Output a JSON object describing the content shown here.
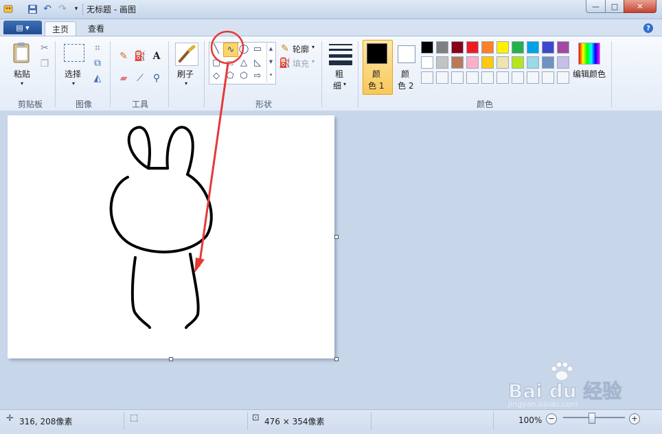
{
  "window": {
    "title": "无标题 - 画图",
    "controls": {
      "minimize": "—",
      "maximize": "□",
      "close": "✕"
    }
  },
  "quick_access": {
    "icons": [
      "app-icon",
      "save-icon",
      "undo-icon",
      "redo-icon",
      "customize-dropdown-icon"
    ]
  },
  "ribbon": {
    "tabs": [
      {
        "label": "主页",
        "active": true
      },
      {
        "label": "查看",
        "active": false
      }
    ],
    "file_menu_icon": "file-menu-icon",
    "help_label": "?",
    "clipboard": {
      "paste_label": "粘贴",
      "group_label": "剪贴板"
    },
    "image": {
      "select_label": "选择",
      "group_label": "图像"
    },
    "tools": {
      "group_label": "工具"
    },
    "brushes": {
      "label": "刷子"
    },
    "shapes": {
      "outline_label": "轮廓",
      "fill_label": "填充",
      "group_label": "形状",
      "selected": "curve"
    },
    "size": {
      "label_line1": "粗",
      "label_line2": "细"
    },
    "colors": {
      "color1_line1": "颜",
      "color1_line2": "色 1",
      "color1_value": "#000000",
      "color2_line1": "颜",
      "color2_line2": "色 2",
      "color2_value": "#ffffff",
      "edit_label": "编辑颜色",
      "group_label": "颜色",
      "palette_row1": [
        "#000000",
        "#7f7f7f",
        "#880015",
        "#ed1c24",
        "#ff7f27",
        "#fff200",
        "#22b14c",
        "#00a2e8",
        "#3f48cc",
        "#a349a4"
      ],
      "palette_row2": [
        "#ffffff",
        "#c3c3c3",
        "#b97a57",
        "#ffaec9",
        "#ffc90e",
        "#efe4b0",
        "#b5e61d",
        "#99d9ea",
        "#7092be",
        "#c8bfe7"
      ]
    }
  },
  "annotation": {
    "color": "#e53935"
  },
  "statusbar": {
    "cursor_pos": "316, 208像素",
    "canvas_size": "476 × 354像素",
    "zoom": "100%",
    "zoom_out": "−",
    "zoom_in": "+"
  },
  "watermark": {
    "brand": "Bai du 经验",
    "url": "jingyan.baidu.com"
  }
}
